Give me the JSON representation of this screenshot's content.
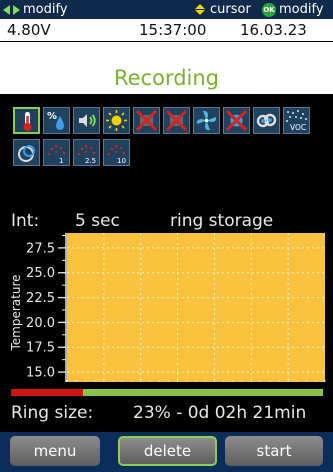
{
  "hintbar": {
    "left_label": "modify",
    "mid_label": "cursor",
    "ok_badge": "OK",
    "right_label": "modify"
  },
  "status": {
    "voltage": "4.80V",
    "time": "15:37:00",
    "date": "16.03.23"
  },
  "title": "Recording",
  "icon_row": [
    "temperature-icon",
    "humidity-icon",
    "sound-icon",
    "light-icon",
    "disabled-sensor-icon",
    "disabled-sensor-icon",
    "fan-icon",
    "disabled-sensor-icon",
    "link-icon",
    "voc-icon",
    "particle-icon",
    "particle-1-icon",
    "particle-2-5-icon",
    "particle-10-icon"
  ],
  "icon_sub_labels": {
    "voc": "VOC",
    "pm1": "1",
    "pm25": "2.5",
    "pm10": "10"
  },
  "interval": {
    "label": "Int:",
    "value": "5 sec",
    "mode": "ring storage"
  },
  "chart_data": {
    "type": "line",
    "ylabel": "Temperature",
    "ytick_labels": [
      "27.5",
      "25.0",
      "22.5",
      "20.0",
      "17.5",
      "15.0"
    ],
    "ylim": [
      14.0,
      29.0
    ],
    "series": [],
    "grid": true,
    "plot_background": "#f9c23c"
  },
  "ring": {
    "label": "Ring size:",
    "summary": "23% - 0d 02h 21min",
    "percent": 23
  },
  "buttons": {
    "menu": "menu",
    "delete": "delete",
    "start": "start"
  },
  "colors": {
    "accent": "#8bd04a",
    "title_green": "#7ab32a",
    "ring_used": "#cc1414",
    "ring_free": "#8bc34a"
  }
}
